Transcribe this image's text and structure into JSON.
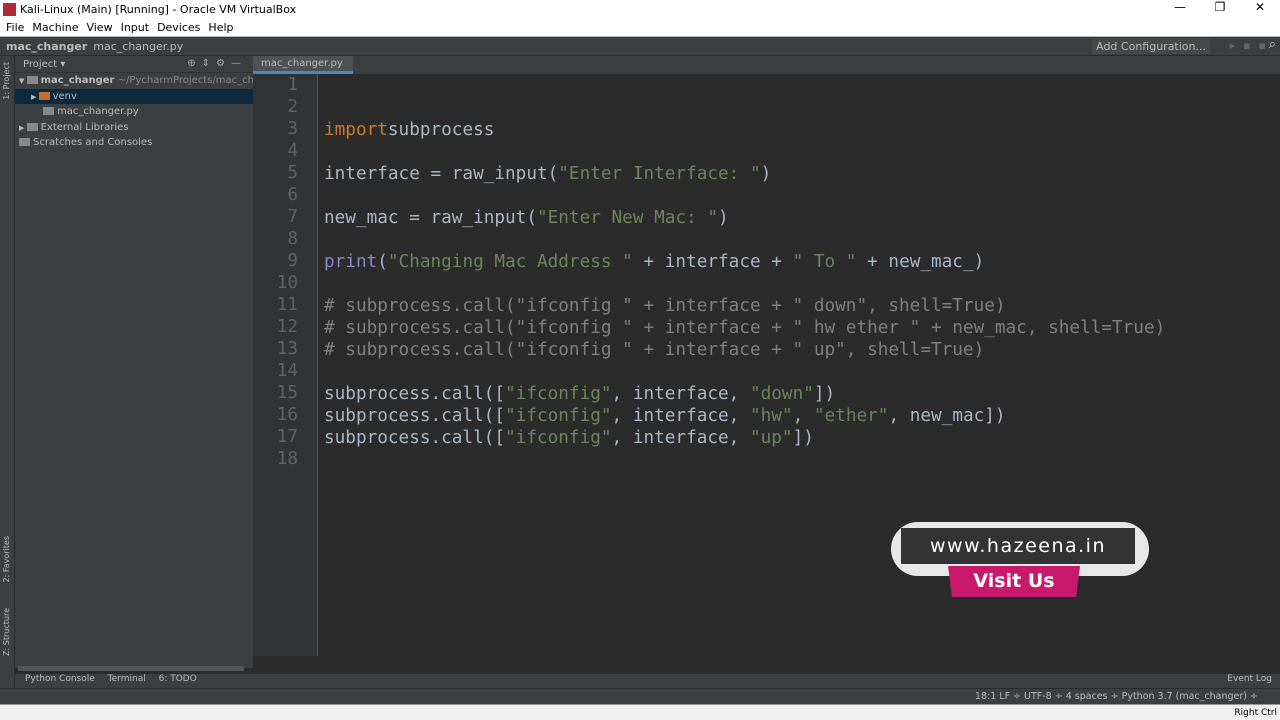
{
  "window": {
    "title": "Kali-Linux (Main) [Running] - Oracle VM VirtualBox",
    "minimize": "—",
    "restore": "❐",
    "close": "✕"
  },
  "menu": [
    "File",
    "Machine",
    "View",
    "Input",
    "Devices",
    "Help"
  ],
  "nav": {
    "project": "mac_changer",
    "file": "mac_changer.py",
    "add_config": "Add Configuration...",
    "search_icon": "⌕"
  },
  "sidebar": {
    "left_label_top": "1: Project",
    "left_label_fav": "2: Favorites",
    "left_label_struct": "Z: Structure",
    "header": "Project ▾",
    "tree": [
      {
        "label": "mac_changer",
        "suffix": " ~/PycharmProjects/mac_changer",
        "indent": 0,
        "arrow": "▼",
        "selected": false,
        "bold": true
      },
      {
        "label": "venv",
        "indent": 1,
        "arrow": "▶",
        "selected": true
      },
      {
        "label": "mac_changer.py",
        "indent": 2,
        "arrow": "",
        "selected": false
      },
      {
        "label": "External Libraries",
        "indent": 0,
        "arrow": "▶",
        "selected": false
      },
      {
        "label": "Scratches and Consoles",
        "indent": 0,
        "arrow": "",
        "selected": false
      }
    ]
  },
  "editor": {
    "tab": "mac_changer.py",
    "lines": [
      [],
      [],
      [
        [
          "kw",
          "import"
        ],
        [
          "",
          "subprocess"
        ]
      ],
      [],
      [
        [
          "",
          "interface = raw_input("
        ],
        [
          "str",
          "\"Enter Interface: \""
        ],
        [
          "",
          ")"
        ]
      ],
      [],
      [
        [
          "",
          "new_mac = raw_input("
        ],
        [
          "str",
          "\"Enter New Mac: \""
        ],
        [
          "",
          ")"
        ]
      ],
      [],
      [
        [
          "bi",
          "print"
        ],
        [
          "",
          "("
        ],
        [
          "str",
          "\"Changing Mac Address \""
        ],
        [
          "",
          " + interface + "
        ],
        [
          "str",
          "\" To \""
        ],
        [
          "",
          " + new_mac_)"
        ]
      ],
      [],
      [
        [
          "com",
          "# subprocess.call(\"ifconfig \" + interface + \" down\", shell=True)"
        ]
      ],
      [
        [
          "com",
          "# subprocess.call(\"ifconfig \" + interface + \" hw ether \" + new_mac, shell=True)"
        ]
      ],
      [
        [
          "com",
          "# subprocess.call(\"ifconfig \" + interface + \" up\", shell=True)"
        ]
      ],
      [],
      [
        [
          "",
          "subprocess.call(["
        ],
        [
          "str",
          "\"ifconfig\""
        ],
        [
          "",
          ", interface, "
        ],
        [
          "str",
          "\"down\""
        ],
        [
          "",
          "])"
        ]
      ],
      [
        [
          "",
          "subprocess.call(["
        ],
        [
          "str",
          "\"ifconfig\""
        ],
        [
          "",
          ", interface, "
        ],
        [
          "str",
          "\"hw\""
        ],
        [
          "",
          ", "
        ],
        [
          "str",
          "\"ether\""
        ],
        [
          "",
          ", new_mac])"
        ]
      ],
      [
        [
          "",
          "subprocess.call(["
        ],
        [
          "str",
          "\"ifconfig\""
        ],
        [
          "",
          ", interface, "
        ],
        [
          "str",
          "\"up\""
        ],
        [
          "",
          "])"
        ]
      ],
      []
    ]
  },
  "bottom": {
    "python_console": "Python Console",
    "terminal": "Terminal",
    "todo": "6: TODO",
    "event_log": "Event Log"
  },
  "status": {
    "text": "18:1  LF ÷  UTF-8 ÷  4 spaces ÷  Python 3.7 (mac_changer) ÷"
  },
  "vbox": {
    "host_key": "Right Ctrl"
  },
  "banner": {
    "url": "www.hazeena.in",
    "cta": "Visit Us"
  }
}
